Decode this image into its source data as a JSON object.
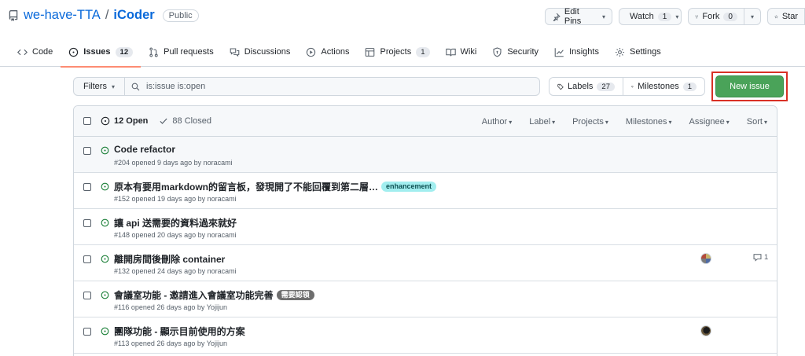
{
  "repo": {
    "owner": "we-have-TTA",
    "slash": "/",
    "name": "iCoder",
    "visibility": "Public"
  },
  "header_actions": {
    "edit_pins": "Edit Pins",
    "watch": "Watch",
    "watch_count": "1",
    "fork": "Fork",
    "fork_count": "0",
    "star": "Star"
  },
  "tabs": [
    {
      "label": "Code",
      "icon": "code-icon"
    },
    {
      "label": "Issues",
      "icon": "issue-opened-icon",
      "badge": "12",
      "active": true
    },
    {
      "label": "Pull requests",
      "icon": "git-pull-request-icon"
    },
    {
      "label": "Discussions",
      "icon": "comment-discussion-icon"
    },
    {
      "label": "Actions",
      "icon": "play-icon"
    },
    {
      "label": "Projects",
      "icon": "table-icon",
      "badge": "1"
    },
    {
      "label": "Wiki",
      "icon": "book-icon"
    },
    {
      "label": "Security",
      "icon": "shield-icon"
    },
    {
      "label": "Insights",
      "icon": "graph-icon"
    },
    {
      "label": "Settings",
      "icon": "gear-icon"
    }
  ],
  "toolbar": {
    "filters": "Filters",
    "search_value": "is:issue is:open",
    "labels": "Labels",
    "labels_count": "27",
    "milestones": "Milestones",
    "milestones_count": "1",
    "new_issue": "New issue"
  },
  "list_header": {
    "open": "12 Open",
    "closed": "88 Closed",
    "filters": [
      "Author",
      "Label",
      "Projects",
      "Milestones",
      "Assignee",
      "Sort"
    ]
  },
  "issues": [
    {
      "title": "Code refactor",
      "meta": "#204 opened 9 days ago by noracami"
    },
    {
      "title": "原本有要用markdown的留言板，發現開了不能回覆到第二層…",
      "label": "enhancement",
      "meta": "#152 opened 19 days ago by noracami"
    },
    {
      "title": "讓 api 送需要的資料過來就好",
      "meta": "#148 opened 20 days ago by noracami"
    },
    {
      "title": "離開房間後刪除 container",
      "meta": "#132 opened 24 days ago by noracami",
      "comments": "1"
    },
    {
      "title": "會議室功能 - 邀請進入會議室功能完善",
      "label": "需要認領",
      "meta": "#116 opened 26 days ago by Yojijun"
    },
    {
      "title": "團隊功能 - 顯示目前使用的方案",
      "meta": "#113 opened 26 days ago by Yojijun"
    }
  ],
  "colors": {
    "link": "#0969da",
    "green_button": "#4aa359",
    "open_green": "#1a7f37",
    "tab_underline": "#fd8c73",
    "highlight_box": "#d93025"
  }
}
